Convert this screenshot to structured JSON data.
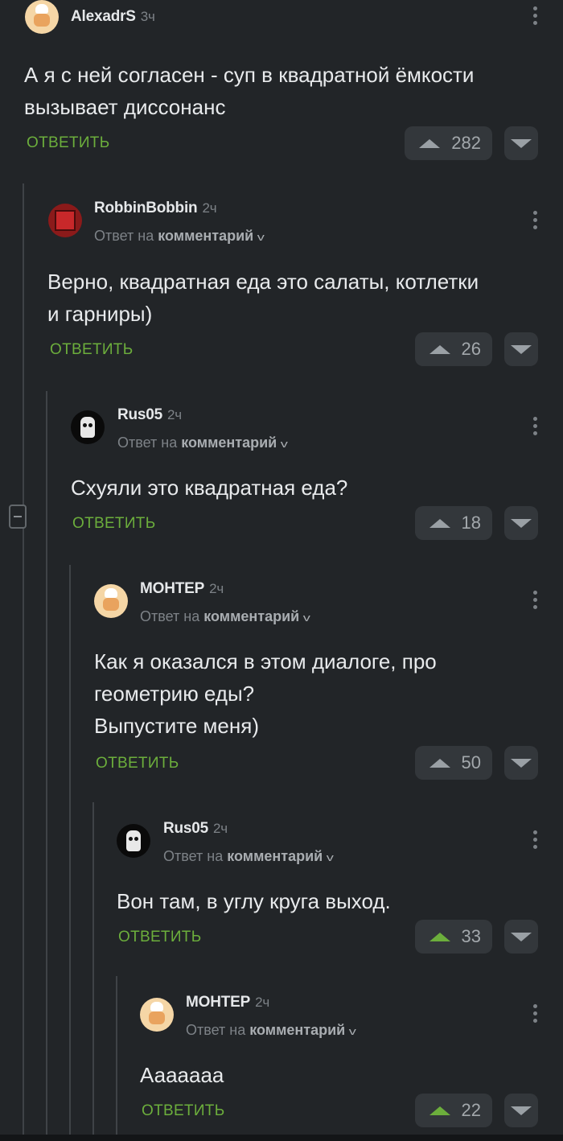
{
  "comments": [
    {
      "author": "AlexadrS",
      "time": "3ч",
      "text": "А я с ней согласен - суп в квадратной ёмкости\nвызывает диссонанс",
      "reply_label": "ОТВЕТИТЬ",
      "votes": "282",
      "upvoted": false,
      "avatar_icon": "pikabu-avatar"
    },
    {
      "author": "RobbinBobbin",
      "time": "2ч",
      "reply_to_prefix": "Ответ на",
      "reply_to_link": "комментарий",
      "text": "Верно, квадратная еда это салаты, котлетки\nи гарниры)",
      "reply_label": "ОТВЕТИТЬ",
      "votes": "26",
      "upvoted": false,
      "avatar_icon": "red-square-avatar"
    },
    {
      "author": "Rus05",
      "time": "2ч",
      "reply_to_prefix": "Ответ на",
      "reply_to_link": "комментарий",
      "text": "Схуяли это квадратная еда?",
      "reply_label": "ОТВЕТИТЬ",
      "votes": "18",
      "upvoted": false,
      "avatar_icon": "skull-avatar"
    },
    {
      "author": "МОНТЕР",
      "time": "2ч",
      "reply_to_prefix": "Ответ на",
      "reply_to_link": "комментарий",
      "text": "Как я оказался в этом диалоге, про\nгеометрию еды?\nВыпустите меня)",
      "reply_label": "ОТВЕТИТЬ",
      "votes": "50",
      "upvoted": false,
      "avatar_icon": "pikabu-avatar"
    },
    {
      "author": "Rus05",
      "time": "2ч",
      "reply_to_prefix": "Ответ на",
      "reply_to_link": "комментарий",
      "text": "Вон там, в углу круга выход.",
      "reply_label": "ОТВЕТИТЬ",
      "votes": "33",
      "upvoted": true,
      "avatar_icon": "skull-avatar"
    },
    {
      "author": "МОНТЕР",
      "time": "2ч",
      "reply_to_prefix": "Ответ на",
      "reply_to_link": "комментарий",
      "text": "Аааааaa",
      "reply_label": "ОТВЕТИТЬ",
      "votes": "22",
      "upvoted": true,
      "avatar_icon": "pikabu-avatar"
    }
  ],
  "colors": {
    "background": "#222528",
    "accent_green": "#6cae3c",
    "vote_button": "#33373b",
    "thread_line": "#3f4347"
  }
}
